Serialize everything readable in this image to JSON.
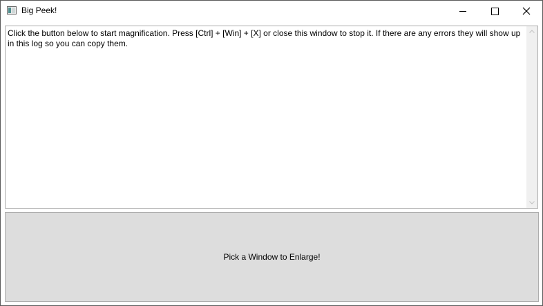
{
  "window": {
    "title": "Big Peek!"
  },
  "caption_buttons": {
    "minimize_icon": "minimize-icon",
    "maximize_icon": "maximize-icon",
    "close_icon": "close-icon"
  },
  "log": {
    "text": "Click the button below to start magnification. Press [Ctrl] + [Win] + [X] or close this window to stop it. If there are any errors they will show up in this log so you can copy them."
  },
  "actions": {
    "enlarge_label": "Pick a Window to Enlarge!"
  },
  "colors": {
    "button_background": "#dddddd",
    "button_border": "#adadad",
    "scrollbar_track": "#f0f0f0"
  }
}
